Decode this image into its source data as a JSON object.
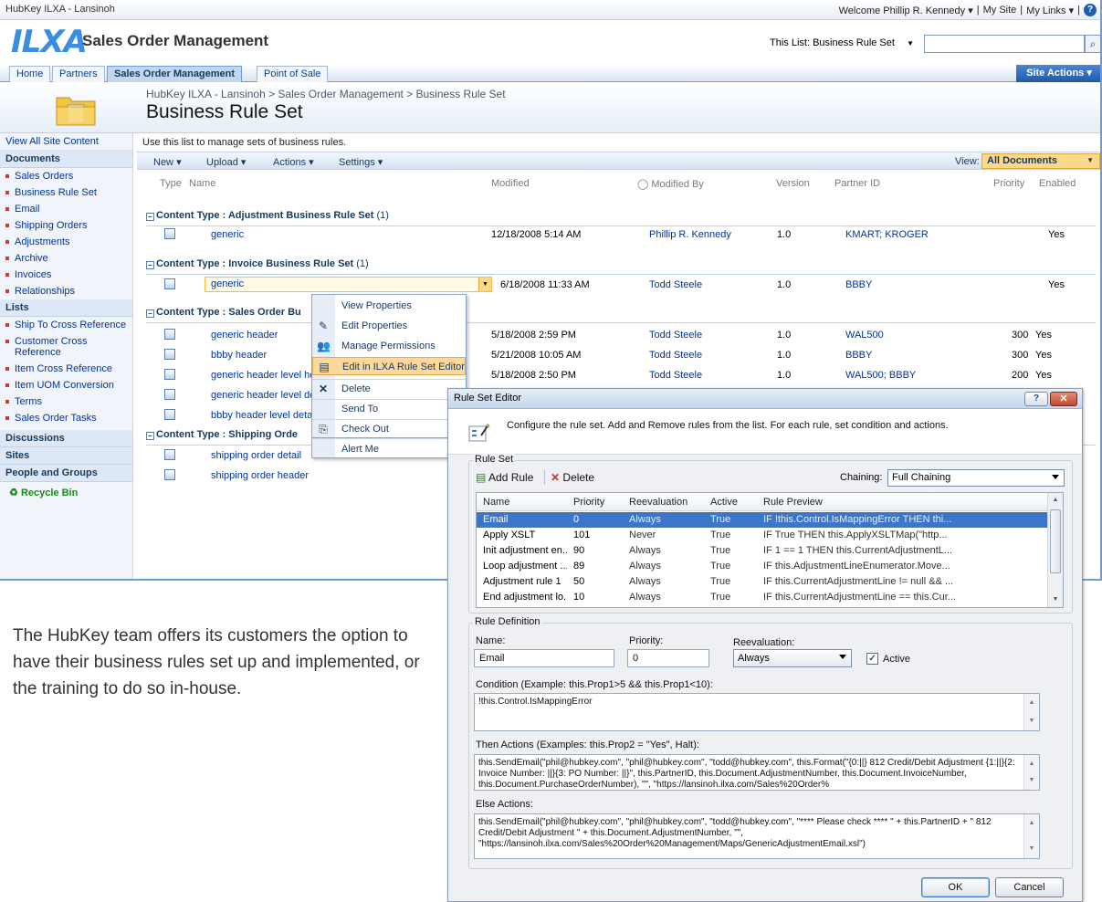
{
  "topbar": {
    "site": "HubKey ILXA - Lansinoh",
    "welcome": "Welcome Phillip R. Kennedy",
    "my_site": "My Site",
    "my_links": "My Links"
  },
  "header": {
    "logo": "ILXA",
    "app_title": "Sales Order Management",
    "search_scope": "This List: Business Rule Set"
  },
  "tabs": [
    "Home",
    "Partners",
    "Sales Order Management",
    "Point of Sale"
  ],
  "site_actions": "Site Actions",
  "breadcrumb": "HubKey ILXA - Lansinoh > Sales Order Management > Business Rule Set",
  "page_title": "Business Rule Set",
  "quicklaunch": {
    "view_all": "View All Site Content",
    "documents_head": "Documents",
    "documents": [
      "Sales Orders",
      "Business Rule Set",
      "Email",
      "Shipping Orders",
      "Adjustments",
      "Archive",
      "Invoices",
      "Relationships"
    ],
    "lists_head": "Lists",
    "lists": [
      "Ship To Cross Reference",
      "Customer Cross Reference",
      "Item Cross Reference",
      "Item UOM Conversion",
      "Terms",
      "Sales Order Tasks"
    ],
    "discussions": "Discussions",
    "sites": "Sites",
    "people": "People and Groups",
    "recycle": "Recycle Bin"
  },
  "list": {
    "description": "Use this list to manage sets of business rules.",
    "toolbar": {
      "new": "New",
      "upload": "Upload",
      "actions": "Actions",
      "settings": "Settings",
      "view_label": "View:",
      "view_value": "All Documents"
    },
    "columns": {
      "type": "Type",
      "name": "Name",
      "modified": "Modified",
      "modified_by": "Modified By",
      "version": "Version",
      "partner_id": "Partner ID",
      "priority": "Priority",
      "enabled": "Enabled"
    },
    "ct_prefix": "Content Type :",
    "groups": [
      {
        "type": "Adjustment Business Rule Set",
        "count": "(1)"
      },
      {
        "type": "Invoice Business Rule Set",
        "count": "(1)"
      },
      {
        "type": "Sales Order Bu",
        "count": ""
      },
      {
        "type": "Shipping Orde",
        "count": ""
      }
    ],
    "rows": [
      {
        "name": "generic",
        "modified": "12/18/2008 5:14 AM",
        "by": "Phillip R. Kennedy",
        "version": "1.0",
        "partner": "KMART; KROGER",
        "priority": "",
        "enabled": "Yes"
      },
      {
        "name": "generic",
        "modified": "6/18/2008 11:33 AM",
        "by": "Todd Steele",
        "version": "1.0",
        "partner": "BBBY",
        "priority": "",
        "enabled": "Yes"
      },
      {
        "name": "generic header",
        "modified": "5/18/2008 2:59 PM",
        "by": "Todd Steele",
        "version": "1.0",
        "partner": "WAL500",
        "priority": "300",
        "enabled": "Yes"
      },
      {
        "name": "bbby header",
        "modified": "5/21/2008 10:05 AM",
        "by": "Todd Steele",
        "version": "1.0",
        "partner": "BBBY",
        "priority": "300",
        "enabled": "Yes"
      },
      {
        "name": "generic header level hea",
        "modified": "5/18/2008 2:50 PM",
        "by": "Todd Steele",
        "version": "1.0",
        "partner": "WAL500; BBBY",
        "priority": "200",
        "enabled": "Yes"
      },
      {
        "name": "generic header level deta"
      },
      {
        "name": "bbby header level detail"
      },
      {
        "name": "shipping order detail"
      },
      {
        "name": "shipping order header"
      }
    ]
  },
  "context_menu": [
    "View Properties",
    "Edit Properties",
    "Manage Permissions",
    "Edit in ILXA Rule Set Editor",
    "Delete",
    "Send To",
    "Check Out",
    "Alert Me"
  ],
  "blurb": "The HubKey team offers its customers the option to have their business rules set up and implemented, or the training to do so in-house.",
  "dialog": {
    "title": "Rule Set Editor",
    "help": "?",
    "intro": "Configure the rule set. Add and Remove rules from the list. For each rule, set condition and actions.",
    "ruleset_label": "Rule Set",
    "add_rule": "Add Rule",
    "delete": "Delete",
    "chaining_label": "Chaining:",
    "chaining_value": "Full Chaining",
    "grid_cols": {
      "name": "Name",
      "priority": "Priority",
      "reevaluation": "Reevaluation",
      "active": "Active",
      "preview": "Rule Preview"
    },
    "rules": [
      {
        "name": "Email",
        "priority": "0",
        "reev": "Always",
        "active": "True",
        "preview": "IF !this.Control.IsMappingError THEN thi..."
      },
      {
        "name": "Apply XSLT",
        "priority": "101",
        "reev": "Never",
        "active": "True",
        "preview": "IF True THEN this.ApplyXSLTMap(\"http..."
      },
      {
        "name": "Init adjustment en...",
        "priority": "90",
        "reev": "Always",
        "active": "True",
        "preview": "IF 1 == 1 THEN this.CurrentAdjustmentL..."
      },
      {
        "name": "Loop adjustment ...",
        "priority": "89",
        "reev": "Always",
        "active": "True",
        "preview": "IF this.AdjustmentLineEnumerator.Move..."
      },
      {
        "name": "Adjustment rule 1",
        "priority": "50",
        "reev": "Always",
        "active": "True",
        "preview": "IF this.CurrentAdjustmentLine != null && ..."
      },
      {
        "name": "End adjustment lo...",
        "priority": "10",
        "reev": "Always",
        "active": "True",
        "preview": "IF this.CurrentAdjustmentLine == this.Cur..."
      }
    ],
    "def_label": "Rule Definition",
    "name_label": "Name:",
    "name_value": "Email",
    "priority_label": "Priority:",
    "priority_value": "0",
    "reev_label": "Reevaluation:",
    "reev_value": "Always",
    "active_label": "Active",
    "condition_label": "Condition (Example: this.Prop1>5 && this.Prop1<10):",
    "condition_value": "!this.Control.IsMappingError",
    "then_label": "Then Actions (Examples: this.Prop2 = \"Yes\", Halt):",
    "then_value": "this.SendEmail(\"phil@hubkey.com\", \"phil@hubkey.com\", \"todd@hubkey.com\", this.Format(\"{0:||}  812 Credit/Debit Adjustment {1:||}{2:  Invoice Number: ||}{3:  PO Number: ||}\", this.PartnerID, this.Document.AdjustmentNumber, this.Document.InvoiceNumber, this.Document.PurchaseOrderNumber), \"\", \"https://lansinoh.ilxa.com/Sales%20Order%",
    "else_label": "Else Actions:",
    "else_value": "this.SendEmail(\"phil@hubkey.com\", \"phil@hubkey.com\", \"todd@hubkey.com\", \"**** Please check **** \" + this.PartnerID + \" 812 Credit/Debit Adjustment \" + this.Document.AdjustmentNumber, \"\", \"https://lansinoh.ilxa.com/Sales%20Order%20Management/Maps/GenericAdjustmentEmail.xsl\")",
    "ok": "OK",
    "cancel": "Cancel"
  }
}
